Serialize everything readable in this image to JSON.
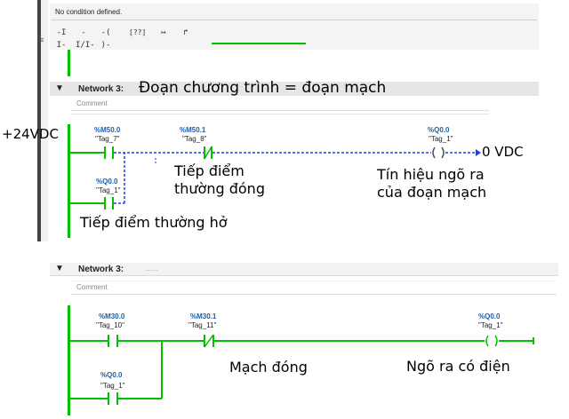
{
  "top_panel": {
    "condition_text": "No condition defined."
  },
  "toolbar": {
    "icons": [
      "no-contact-icon",
      "nc-contact-icon",
      "coil-icon",
      "box-icon",
      "branch-open-icon",
      "branch-close-icon"
    ],
    "glyphs": [
      "-I I-",
      "-I/I-",
      "-( )-",
      "[??]",
      "↦",
      "↱"
    ]
  },
  "network_upper": {
    "label": "Network 3:",
    "title": "Đoạn chương trình = đoạn mạch",
    "comment": "Comment",
    "contacts": [
      {
        "address": "%M50.0",
        "tag": "\"Tag_7\""
      },
      {
        "address": "%M50.1",
        "tag": "\"Tag_8\""
      },
      {
        "address": "%Q0.0",
        "tag": "\"Tag_1\""
      }
    ],
    "coil": {
      "address": "%Q0.0",
      "tag": "\"Tag_1\""
    },
    "annotations": {
      "supply": "+24VDC",
      "zero": "0 VDC",
      "nc_contact_line1": "Tiếp điểm",
      "nc_contact_line2": "thường đóng",
      "output_line1": "Tín hiệu ngõ ra",
      "output_line2": "của đoạn mạch",
      "no_contact": "Tiếp điểm thường hở"
    }
  },
  "network_lower": {
    "label": "Network 3:",
    "title": "......",
    "comment": "Comment",
    "contacts": [
      {
        "address": "%M30.0",
        "tag": "\"Tag_10\""
      },
      {
        "address": "%M30.1",
        "tag": "\"Tag_11\""
      },
      {
        "address": "%Q0.0",
        "tag": "\"Tag_1\""
      }
    ],
    "coil": {
      "address": "%Q0.0",
      "tag": "\"Tag_1\""
    },
    "annotations": {
      "closed_circuit": "Mạch đóng",
      "output_powered": "Ngõ ra có điện"
    }
  },
  "colors": {
    "rail_green": "#00c000",
    "flow_blue": "#1a3cff",
    "address_blue": "#1f5fa8",
    "header_gray": "#e6e6e6"
  }
}
